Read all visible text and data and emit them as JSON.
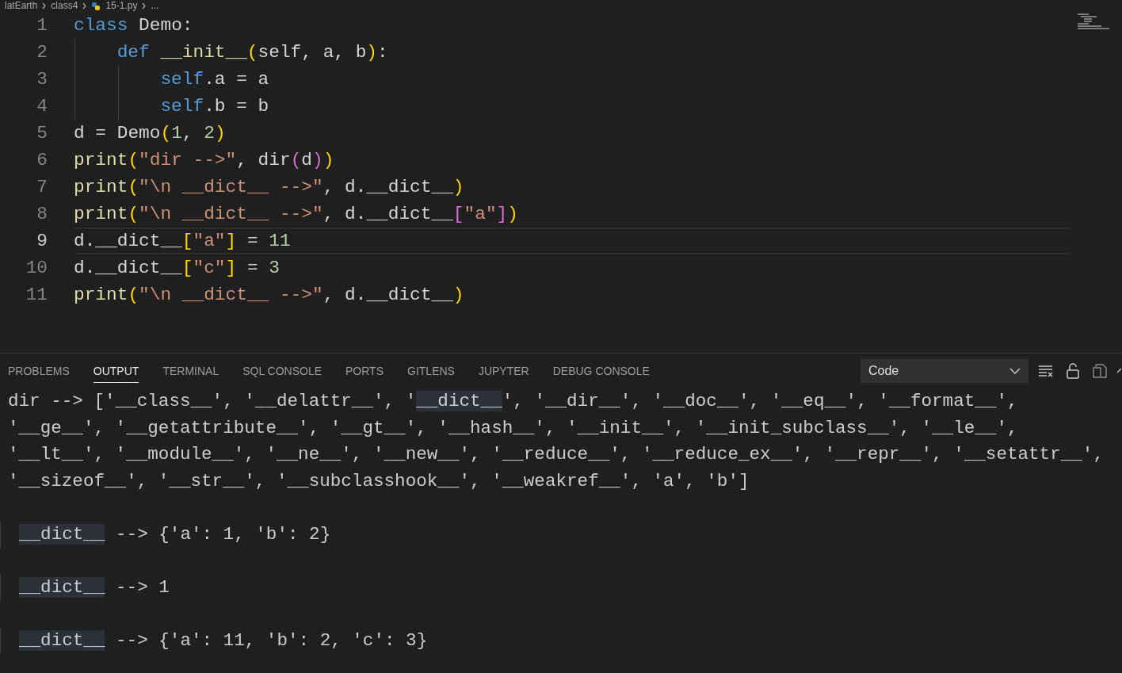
{
  "breadcrumb": [
    "latEarth",
    "class4",
    "15-1.py",
    "..."
  ],
  "editor": {
    "lines": [
      {
        "number": "1",
        "current": false,
        "tokens": [
          {
            "text": "class",
            "kind": "kw"
          },
          {
            "text": " Demo:",
            "kind": "plain"
          }
        ],
        "children": [
          {
            "number": "2",
            "current": false,
            "tokens": [
              {
                "text": "def",
                "kind": "kw"
              },
              {
                "text": " __init__",
                "kind": "fn"
              },
              {
                "text": "(",
                "kind": "b1"
              },
              {
                "text": "self, a, b",
                "kind": "plain"
              },
              {
                "text": ")",
                "kind": "b1"
              },
              {
                "text": ":",
                "kind": "plain"
              }
            ],
            "children": [
              {
                "number": "3",
                "current": false,
                "tokens": [
                  {
                    "text": "self",
                    "kind": "kw"
                  },
                  {
                    "text": ".a = a",
                    "kind": "plain"
                  }
                ]
              },
              {
                "number": "4",
                "current": false,
                "tokens": [
                  {
                    "text": "self",
                    "kind": "kw"
                  },
                  {
                    "text": ".b = b",
                    "kind": "plain"
                  }
                ]
              }
            ]
          }
        ]
      },
      {
        "number": "5",
        "current": false,
        "tokens": [
          {
            "text": "d = Demo",
            "kind": "plain"
          },
          {
            "text": "(",
            "kind": "b1"
          },
          {
            "text": "1",
            "kind": "num"
          },
          {
            "text": ", ",
            "kind": "plain"
          },
          {
            "text": "2",
            "kind": "num"
          },
          {
            "text": ")",
            "kind": "b1"
          }
        ]
      },
      {
        "number": "6",
        "current": false,
        "tokens": [
          {
            "text": "print",
            "kind": "fn"
          },
          {
            "text": "(",
            "kind": "b1"
          },
          {
            "text": "\"dir -->\"",
            "kind": "str"
          },
          {
            "text": ", dir",
            "kind": "plain"
          },
          {
            "text": "(",
            "kind": "b2"
          },
          {
            "text": "d",
            "kind": "plain"
          },
          {
            "text": ")",
            "kind": "b2"
          },
          {
            "text": ")",
            "kind": "b1"
          }
        ]
      },
      {
        "number": "7",
        "current": false,
        "tokens": [
          {
            "text": "print",
            "kind": "fn"
          },
          {
            "text": "(",
            "kind": "b1"
          },
          {
            "text": "\"\\n __dict__ -->\"",
            "kind": "str"
          },
          {
            "text": ", d.__dict__",
            "kind": "plain"
          },
          {
            "text": ")",
            "kind": "b1"
          }
        ]
      },
      {
        "number": "8",
        "current": false,
        "tokens": [
          {
            "text": "print",
            "kind": "fn"
          },
          {
            "text": "(",
            "kind": "b1"
          },
          {
            "text": "\"\\n __dict__ -->\"",
            "kind": "str"
          },
          {
            "text": ", d.__dict__",
            "kind": "plain"
          },
          {
            "text": "[",
            "kind": "b2"
          },
          {
            "text": "\"a\"",
            "kind": "str"
          },
          {
            "text": "]",
            "kind": "b2"
          },
          {
            "text": ")",
            "kind": "b1"
          }
        ]
      },
      {
        "number": "9",
        "current": true,
        "tokens": [
          {
            "text": "d.__dict__",
            "kind": "plain"
          },
          {
            "text": "[",
            "kind": "b1"
          },
          {
            "text": "\"a\"",
            "kind": "str"
          },
          {
            "text": "]",
            "kind": "b1"
          },
          {
            "text": " = ",
            "kind": "plain"
          },
          {
            "text": "11",
            "kind": "num"
          }
        ]
      },
      {
        "number": "10",
        "current": false,
        "tokens": [
          {
            "text": "d.__dict__",
            "kind": "plain"
          },
          {
            "text": "[",
            "kind": "b1"
          },
          {
            "text": "\"c\"",
            "kind": "str"
          },
          {
            "text": "]",
            "kind": "b1"
          },
          {
            "text": " = ",
            "kind": "plain"
          },
          {
            "text": "3",
            "kind": "num"
          }
        ]
      },
      {
        "number": "11",
        "current": false,
        "tokens": [
          {
            "text": "print",
            "kind": "fn"
          },
          {
            "text": "(",
            "kind": "b1"
          },
          {
            "text": "\"\\n __dict__ -->\"",
            "kind": "str"
          },
          {
            "text": ", d.__dict__",
            "kind": "plain"
          },
          {
            "text": ")",
            "kind": "b1"
          }
        ]
      }
    ]
  },
  "panel": {
    "tabs": [
      {
        "label": "PROBLEMS",
        "selected": false
      },
      {
        "label": "OUTPUT",
        "selected": true
      },
      {
        "label": "TERMINAL",
        "selected": false
      },
      {
        "label": "SQL CONSOLE",
        "selected": false
      },
      {
        "label": "PORTS",
        "selected": false
      },
      {
        "label": "GITLENS",
        "selected": false
      },
      {
        "label": "JUPYTER",
        "selected": false
      },
      {
        "label": "DEBUG CONSOLE",
        "selected": false
      }
    ],
    "channel": {
      "value": "Code"
    },
    "output": [
      {
        "kind": "line",
        "segments": [
          {
            "text": "dir --> ['__class__', '__delattr__', '",
            "highlight": false
          },
          {
            "text": "__dict__",
            "highlight": true
          },
          {
            "text": "', '__dir__', '__doc__', '__eq__', '__format__',",
            "highlight": false
          }
        ]
      },
      {
        "kind": "line",
        "segments": [
          {
            "text": "'__ge__', '__getattribute__', '__gt__', '__hash__', '__init__', '__init_subclass__', '__le__',",
            "highlight": false
          }
        ]
      },
      {
        "kind": "line",
        "segments": [
          {
            "text": "'__lt__', '__module__', '__ne__', '__new__', '__reduce__', '__reduce_ex__', '__repr__', '__setattr__',",
            "highlight": false
          }
        ]
      },
      {
        "kind": "line",
        "segments": [
          {
            "text": "'__sizeof__', '__str__', '__subclasshook__', '__weakref__', 'a', 'b']",
            "highlight": false
          }
        ]
      },
      {
        "kind": "block",
        "segments": [
          {
            "text": "__dict__",
            "highlight": true
          },
          {
            "text": " --> {'a': 1, 'b': 2}",
            "highlight": false
          }
        ]
      },
      {
        "kind": "block",
        "segments": [
          {
            "text": "__dict__",
            "highlight": true
          },
          {
            "text": " --> 1",
            "highlight": false
          }
        ]
      },
      {
        "kind": "block",
        "segments": [
          {
            "text": "__dict__",
            "highlight": true
          },
          {
            "text": " --> {'a': 11, 'b': 2, 'c': 3}",
            "highlight": false
          }
        ]
      }
    ]
  }
}
